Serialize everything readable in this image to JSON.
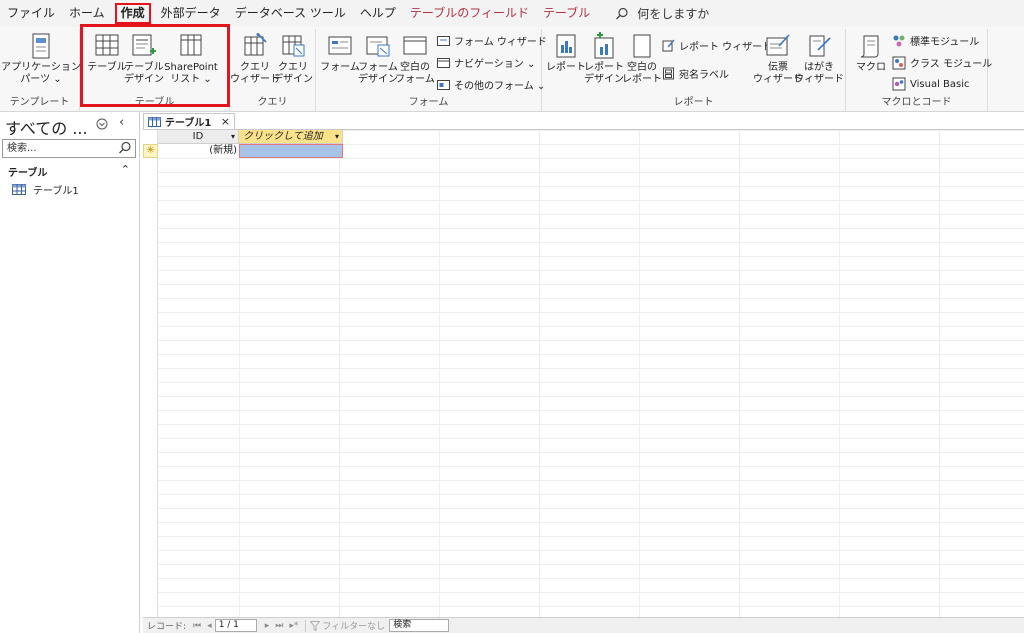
{
  "menu": {
    "tabs": [
      "ファイル",
      "ホーム",
      "作成",
      "外部データ",
      "データベース ツール",
      "ヘルプ",
      "テーブルのフィールド",
      "テーブル"
    ],
    "active_tab": "作成",
    "search_placeholder": "何をしますか"
  },
  "ribbon": {
    "groups": {
      "templates": "テンプレート",
      "tables": "テーブル",
      "queries": "クエリ",
      "forms": "フォーム",
      "reports": "レポート",
      "macros": "マクロとコード"
    },
    "buttons": {
      "app_parts_1": "アプリケーション",
      "app_parts_2": "パーツ ⌄",
      "table": "テーブル",
      "table_design_1": "テーブル",
      "table_design_2": "デザイン",
      "sharepoint_1": "SharePoint",
      "sharepoint_2": "リスト ⌄",
      "query_wizard_1": "クエリ",
      "query_wizard_2": "ウィザード",
      "query_design_1": "クエリ",
      "query_design_2": "デザイン",
      "form": "フォーム",
      "form_design_1": "フォーム",
      "form_design_2": "デザイン",
      "blank_form_1": "空白の",
      "blank_form_2": "フォーム",
      "form_wizard": "フォーム ウィザード",
      "navigation": "ナビゲーション ⌄",
      "other_forms": "その他のフォーム ⌄",
      "report": "レポート",
      "report_design_1": "レポート",
      "report_design_2": "デザイン",
      "blank_report_1": "空白の",
      "blank_report_2": "レポート",
      "report_wizard": "レポート ウィザード",
      "labels": "宛名ラベル",
      "slip_wizard_1": "伝票",
      "slip_wizard_2": "ウィザード",
      "postcard_wizard_1": "はがき",
      "postcard_wizard_2": "ウィザード",
      "macro": "マクロ",
      "std_module": "標準モジュール",
      "class_module": "クラス モジュール",
      "visual_basic": "Visual Basic"
    }
  },
  "nav": {
    "title": "すべての ...",
    "search_placeholder": "検索...",
    "section": "テーブル",
    "items": [
      "テーブル1"
    ]
  },
  "document": {
    "tab": "テーブル1",
    "columns": [
      "ID",
      "クリックして追加"
    ],
    "new_row_value": "(新規)"
  },
  "record_nav": {
    "label": "レコード:",
    "position": "1 / 1",
    "filter": "フィルターなし",
    "search": "検索"
  },
  "colors": {
    "highlight_red": "#e0151f",
    "context_tab": "#b23041",
    "add_column_header": "#fbe28a",
    "selected_cell": "#a7c3e8"
  }
}
